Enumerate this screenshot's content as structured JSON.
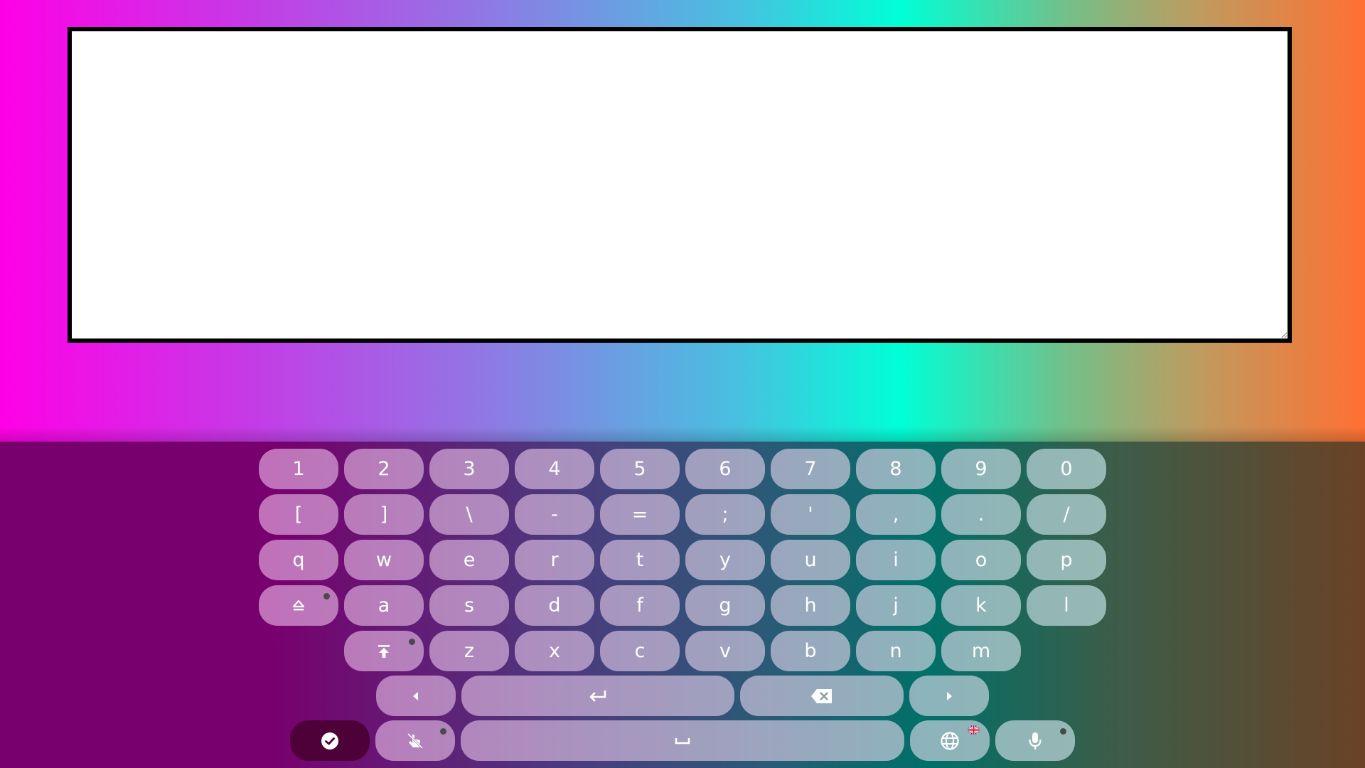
{
  "editor": {
    "value": "",
    "placeholder": ""
  },
  "keyboard": {
    "number_row": [
      "1",
      "2",
      "3",
      "4",
      "5",
      "6",
      "7",
      "8",
      "9",
      "0"
    ],
    "symbol_row": [
      "[",
      "]",
      "\\",
      "-",
      "=",
      ";",
      "'",
      ",",
      ".",
      "/"
    ],
    "row_q": [
      "q",
      "w",
      "e",
      "r",
      "t",
      "y",
      "u",
      "i",
      "o",
      "p"
    ],
    "row_a": [
      "a",
      "s",
      "d",
      "f",
      "g",
      "h",
      "j",
      "k",
      "l"
    ],
    "row_z": [
      "z",
      "x",
      "c",
      "v",
      "b",
      "n",
      "m"
    ],
    "shift_icon": "shift-icon",
    "caps_lock_icon": "caps-lock-icon",
    "left_arrow_icon": "arrow-left-icon",
    "enter_icon": "enter-icon",
    "backspace_icon": "backspace-icon",
    "right_arrow_icon": "arrow-right-icon",
    "done_icon": "check-circle-icon",
    "gesture_off_icon": "swipe-off-icon",
    "space_icon": "space-bar-icon",
    "language_icon": "globe-icon",
    "language_flag": "uk-flag",
    "mic_icon": "microphone-icon"
  },
  "colors": {
    "key_left": "#e48ad4",
    "key_right": "#b2eede",
    "done_key": "#4e0038",
    "indicator_dot": "#4a4a4a",
    "keyboard_left": "#78006e",
    "keyboard_right": "#6a4226"
  }
}
